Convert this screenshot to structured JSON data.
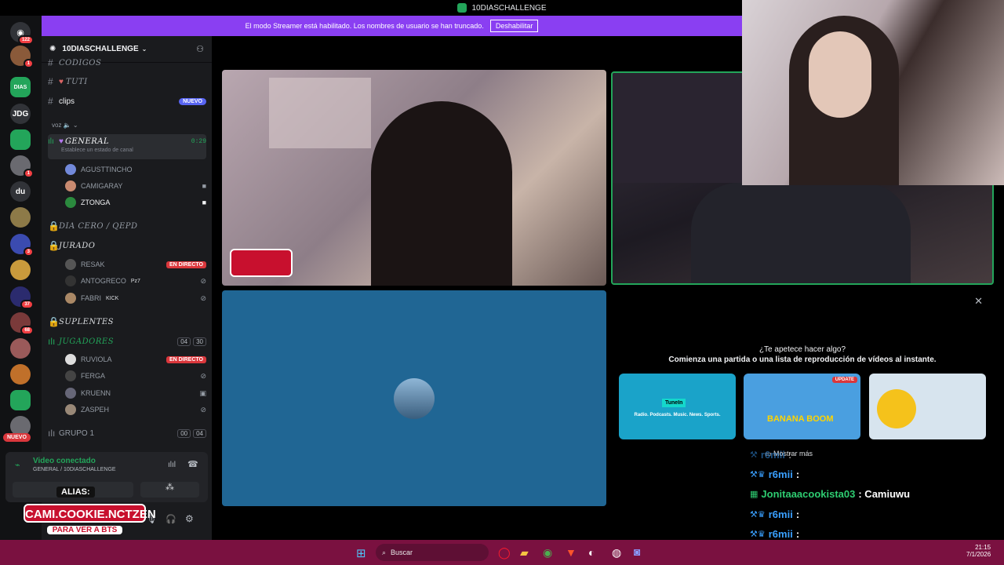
{
  "titlebar": {
    "title": "10DIASCHALLENGE"
  },
  "banner": {
    "text": "El modo Streamer está habilitado. Los nombres de usuario se han truncado.",
    "button": "Deshabilitar"
  },
  "rail": {
    "home_badge": "122",
    "items": [
      {
        "label": "",
        "badge": "1"
      },
      {
        "label": "DIAS",
        "badge": ""
      },
      {
        "label": "JDG",
        "badge": ""
      },
      {
        "label": "",
        "badge": ""
      },
      {
        "label": "",
        "badge": "1"
      },
      {
        "label": "du",
        "badge": ""
      },
      {
        "label": "",
        "badge": ""
      },
      {
        "label": "",
        "badge": "3"
      },
      {
        "label": "",
        "badge": ""
      },
      {
        "label": "",
        "badge": "37"
      },
      {
        "label": "",
        "badge": "68"
      }
    ],
    "new_label": "NUEVO"
  },
  "server": {
    "name": "10DIASCHALLENGE"
  },
  "channels": {
    "codigos": "CODIGOS",
    "tuti": "TUTI",
    "clips": "clips",
    "clips_badge": "NUEVO",
    "voz_label": "voz",
    "general": "GENERAL",
    "general_time": "0:29",
    "general_status": "Establece un estado de canal",
    "general_users": [
      "AGUSTTINCHO",
      "CAMIGARAY",
      "ZTONGA"
    ],
    "dia_cero": "DIA CERO / QEPD",
    "jurado": "JURADO",
    "jurado_users": [
      {
        "name": "RESAK",
        "tag": "EN DIRECTO"
      },
      {
        "name": "ANTOGRECO",
        "tag": "Pz7"
      },
      {
        "name": "FABRI",
        "tag": "KICK"
      }
    ],
    "suplentes": "SUPLENTES",
    "jugadores": "JUGADORES",
    "jugadores_count_a": "04",
    "jugadores_count_b": "30",
    "jugadores_users": [
      {
        "name": "RUVIOLA",
        "tag": "EN DIRECTO"
      },
      {
        "name": "FERGA",
        "tag": ""
      },
      {
        "name": "KRUENN",
        "tag": ""
      },
      {
        "name": "ZASPEH",
        "tag": ""
      }
    ],
    "grupo1": "GRUPO 1",
    "grupo1_count_a": "00",
    "grupo1_count_b": "04"
  },
  "voice_panel": {
    "status": "Video conectado",
    "location": "GENERAL / 10DIASCHALLENGE"
  },
  "overlay_alias": {
    "line1": "ALIAS:",
    "line2": "CAMI.COOKIE.NCTZEN",
    "line3": "PARA VER A BTS"
  },
  "activity": {
    "title": "¿Te apetece hacer algo?",
    "subtitle": "Comienza una partida o una lista de reproducción de vídeos al instante.",
    "cards": [
      {
        "name": "TuneIn",
        "caption": "Radio. Podcasts. Music. News. Sports.",
        "badge": ""
      },
      {
        "name": "BANANA BOOM",
        "caption": "",
        "badge": "UPDATE"
      },
      {
        "name": "",
        "caption": "",
        "badge": ""
      }
    ],
    "show_more": "Mostrar más"
  },
  "chat": [
    {
      "user": "r6mii",
      "msg": ":",
      "color": "#3aa0ff"
    },
    {
      "user": "r6mii",
      "msg": ":",
      "color": "#3aa0ff"
    },
    {
      "user": "Jonitaaacookista03",
      "msg": ": Camiuwu",
      "color": "#2ecc71"
    },
    {
      "user": "r6mii",
      "msg": ":",
      "color": "#3aa0ff"
    },
    {
      "user": "r6mii",
      "msg": ":",
      "color": "#3aa0ff"
    }
  ],
  "taskbar": {
    "search": "Buscar",
    "time": "21:15",
    "date": "7/1/2026"
  }
}
